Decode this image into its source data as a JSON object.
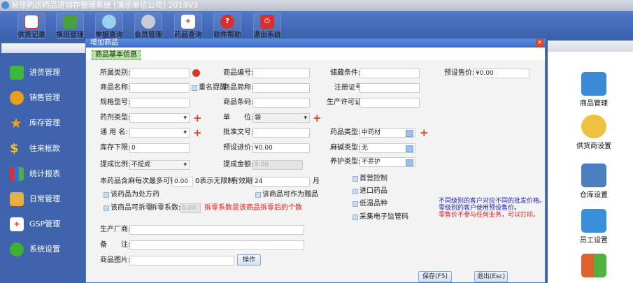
{
  "window": {
    "title": "易佳药店药品进销存管理系统 [演示单位公司] 2019V3"
  },
  "toolbar": [
    "供货记录",
    "换班管理",
    "单据查询",
    "会员管理",
    "药品查询",
    "软件帮助",
    "退出系统"
  ],
  "sidebar": [
    "进货管理",
    "销售管理",
    "库存管理",
    "往来帐款",
    "统计报表",
    "日常管理",
    "GSP管理",
    "系统设置"
  ],
  "right_panel": [
    "商品管理",
    "供货商设置",
    "仓库设置",
    "员工设置"
  ],
  "dialog": {
    "title": "增加商品",
    "tab": "商品基本信息",
    "close": "×",
    "labels": {
      "category": "所属类别:",
      "name": "商品名称:",
      "dup_check": "重名提醒",
      "spec": "规格型号:",
      "dosage": "药剂类型:",
      "generic": "通 用 名:",
      "stock_min": "库存下限:",
      "commission_ratio": "提成比例:",
      "code": "商品编号:",
      "short_name": "商品简称:",
      "barcode": "商品条码:",
      "unit": "单　　位:",
      "approval": "批准文号:",
      "purchase_price": "预设进价:",
      "commission_amount": "提成金额:",
      "storage": "储藏条件:",
      "reg_no": "注册证号:",
      "license": "生产许可证:",
      "drug_type": "药品类型:",
      "ephedrine": "麻碱类型:",
      "maintenance": "养护类型:",
      "sale_price": "预设售价:",
      "max_per_sale": "本药品含麻每次最多可销售:",
      "no_limit": "0表示无限制",
      "validity": "有效期:",
      "month": "月",
      "prescription": "该药品为处方药",
      "gift": "该商品可作为赠品",
      "split": "该商品可拆零",
      "split_coef": "拆零系数:",
      "split_hint": "拆零系数是该商品拆零后的个数",
      "first_control": "首营控制",
      "imported": "进口药品",
      "low_temp": "低温品种",
      "e_code": "采集电子监管码",
      "manufacturer": "生产厂商:",
      "remark": "备　　注:",
      "picture": "商品图片:"
    },
    "values": {
      "stock_min": "0",
      "commission_ratio": "不提成",
      "unit": "袋",
      "purchase_price": "¥0.00",
      "commission_amount": "0.00",
      "drug_type": "中药材",
      "ephedrine": "无",
      "maintenance": "不养护",
      "sale_price": "¥0.00",
      "max_per_sale": "0.00",
      "validity": "24",
      "split_coef": "0.00"
    },
    "notes": {
      "line1": "不同级别的客户对应不同的批发价格。",
      "line2": "零级别的客户使用预设售价。",
      "line3": "零售价不参与任何业务，可以打印。"
    },
    "buttons": {
      "operate": "操作",
      "save": "保存(F5)",
      "exit": "退出(Esc)"
    }
  }
}
